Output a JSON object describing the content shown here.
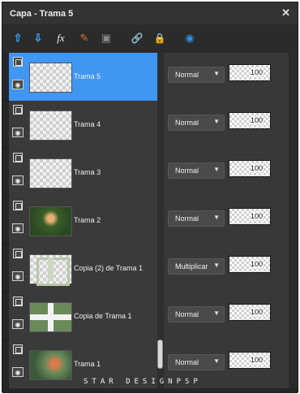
{
  "window": {
    "title": "Capa - Trama 5",
    "close": "✕"
  },
  "toolbar": {
    "icons": [
      {
        "name": "move-layer-up-icon",
        "glyph": "⇧"
      },
      {
        "name": "move-layer-down-icon",
        "glyph": "⇩"
      },
      {
        "name": "effects-icon",
        "glyph": "fx"
      },
      {
        "name": "edit-selection-icon",
        "glyph": "✎"
      },
      {
        "name": "mask-icon",
        "glyph": "▣"
      },
      {
        "name": "link-icon",
        "glyph": "🔗"
      },
      {
        "name": "lock-icon",
        "glyph": "🔒"
      },
      {
        "name": "highlight-icon",
        "glyph": "◉"
      }
    ]
  },
  "layers": [
    {
      "name": "Trama 5",
      "blend": "Normal",
      "opacity": "100",
      "selected": true,
      "thumb": "transparent"
    },
    {
      "name": "Trama 4",
      "blend": "Normal",
      "opacity": "100",
      "selected": false,
      "thumb": "transparent"
    },
    {
      "name": "Trama 3",
      "blend": "Normal",
      "opacity": "100",
      "selected": false,
      "thumb": "transparent"
    },
    {
      "name": "Trama 2",
      "blend": "Normal",
      "opacity": "100",
      "selected": false,
      "thumb": "photo1"
    },
    {
      "name": "Copia (2) de Trama 1",
      "blend": "Multiplicar",
      "opacity": "100",
      "selected": false,
      "thumb": "grid"
    },
    {
      "name": "Copia de Trama 1",
      "blend": "Normal",
      "opacity": "100",
      "selected": false,
      "thumb": "cross"
    },
    {
      "name": "Trama 1",
      "blend": "Normal",
      "opacity": "100",
      "selected": false,
      "thumb": "photo2"
    }
  ],
  "watermark": "STAR DESIGNPSP",
  "colors": {
    "selected": "#3f97f2",
    "panel": "#2b2b2b"
  }
}
